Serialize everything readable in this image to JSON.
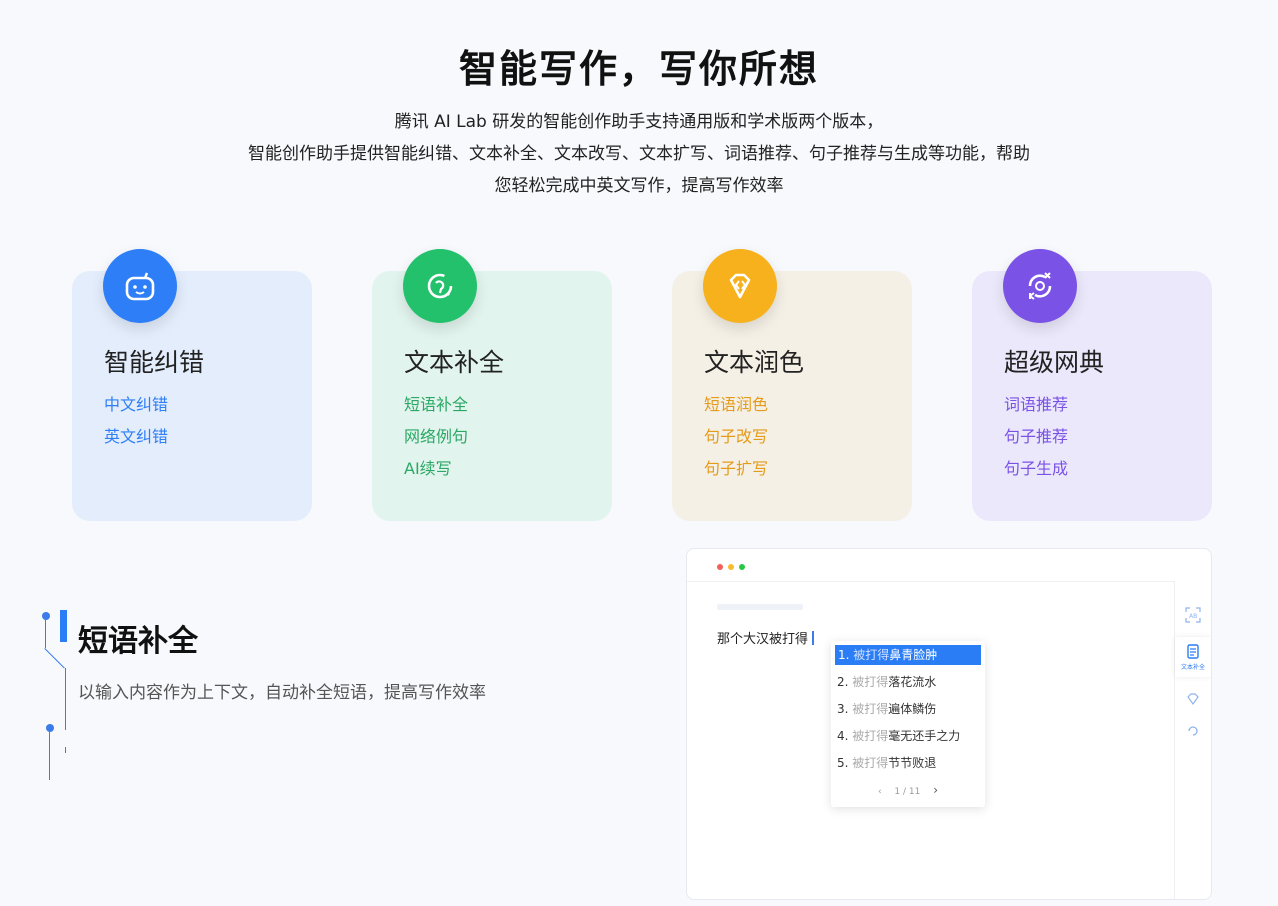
{
  "hero": {
    "title": "智能写作，写你所想",
    "desc_line1": "腾讯 AI Lab 研发的智能创作助手支持通用版和学术版两个版本，",
    "desc_line2": "智能创作助手提供智能纠错、文本补全、文本改写、文本扩写、词语推荐、句子推荐与生成等功能，帮助",
    "desc_line3": "您轻松完成中英文写作，提高写作效率"
  },
  "cards": [
    {
      "title": "智能纠错",
      "icon": "robot-face-icon",
      "bg": "#e3edfc",
      "badge": "#2d7ef7",
      "text_color": "#2d7ef7",
      "items": [
        "中文纠错",
        "英文纠错"
      ]
    },
    {
      "title": "文本补全",
      "icon": "chat-loop-icon",
      "bg": "#e2f4ee",
      "badge": "#23c16b",
      "text_color": "#2aa864",
      "items": [
        "短语补全",
        "网络例句",
        "AI续写"
      ]
    },
    {
      "title": "文本润色",
      "icon": "gem-code-icon",
      "bg": "#f5f0e6",
      "badge": "#f6b11d",
      "text_color": "#e59b1a",
      "items": [
        "短语润色",
        "句子改写",
        "句子扩写"
      ]
    },
    {
      "title": "超级网典",
      "icon": "cycle-arrows-icon",
      "bg": "#ebe8fb",
      "badge": "#7b52e6",
      "text_color": "#7b52e6",
      "items": [
        "词语推荐",
        "句子推荐",
        "句子生成"
      ]
    }
  ],
  "feature": {
    "title": "短语补全",
    "desc": "以输入内容作为上下文，自动补全短语，提高写作效率"
  },
  "mock": {
    "editor_text": "那个大汉被打得",
    "suggestions": [
      {
        "num": "1.",
        "prefix": "被打得",
        "text": "鼻青脸肿"
      },
      {
        "num": "2.",
        "prefix": "被打得",
        "text": "落花流水"
      },
      {
        "num": "3.",
        "prefix": "被打得",
        "text": "遍体鳞伤"
      },
      {
        "num": "4.",
        "prefix": "被打得",
        "text": "毫无还手之力"
      },
      {
        "num": "5.",
        "prefix": "被打得",
        "text": "节节败退"
      }
    ],
    "pager": "1 / 11",
    "rail_label": "文本补全",
    "dot_colors": [
      "#f25f57",
      "#f8bd2e",
      "#2ac840"
    ]
  }
}
